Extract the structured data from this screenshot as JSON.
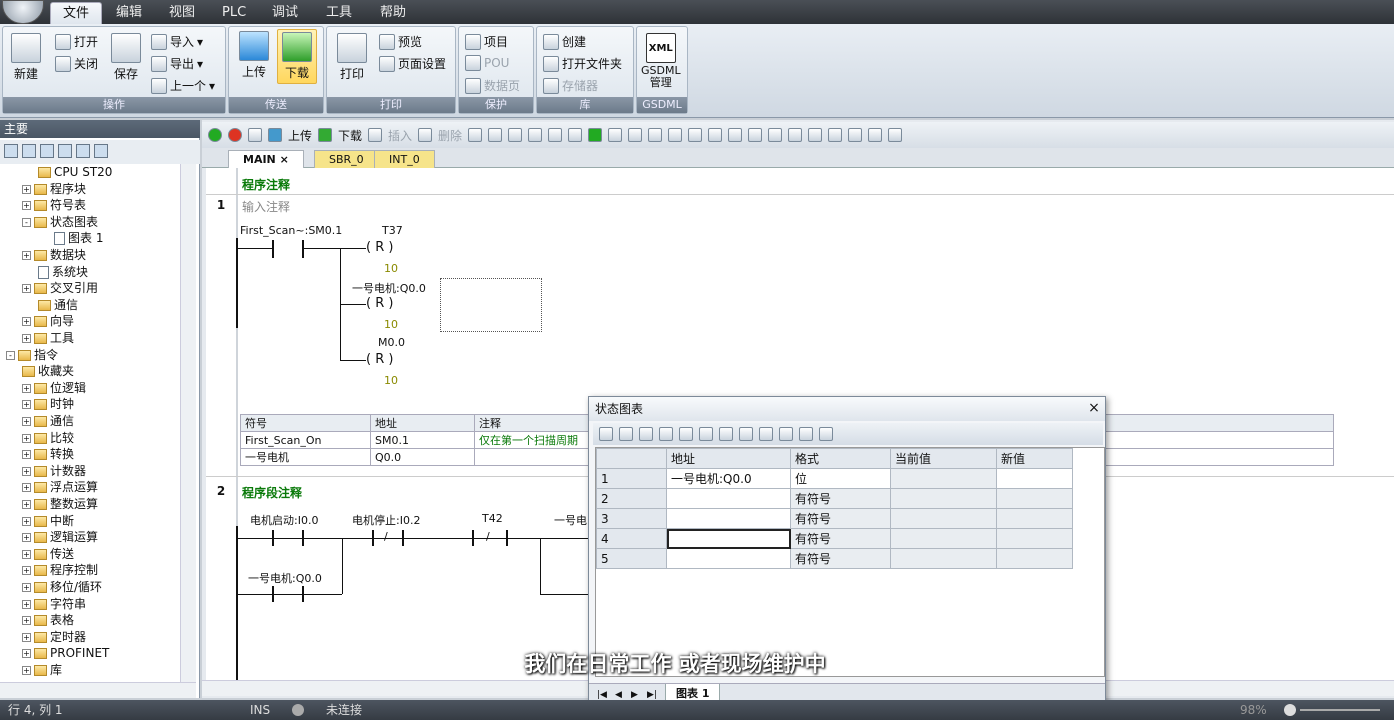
{
  "menubar": {
    "items": [
      "文件",
      "编辑",
      "视图",
      "PLC",
      "调试",
      "工具",
      "帮助"
    ]
  },
  "ribbon": {
    "groups": {
      "ops": {
        "label": "操作",
        "new": "新建",
        "open": "打开",
        "close": "关闭",
        "save": "保存",
        "import": "导入",
        "export": "导出",
        "prev": "上一个"
      },
      "transfer": {
        "label": "传送",
        "upload": "上传",
        "download": "下载"
      },
      "print": {
        "label": "打印",
        "print": "打印",
        "preview": "预览",
        "page_setup": "页面设置"
      },
      "protect": {
        "label": "保护",
        "project": "项目",
        "pou": "POU",
        "datapage": "数据页"
      },
      "library": {
        "label": "库",
        "create": "创建",
        "open_folder": "打开文件夹",
        "storage": "存储器"
      },
      "gsdml": {
        "label": "GSDML",
        "btn": "GSDML\n管理",
        "xml": "XML"
      }
    }
  },
  "left_panel": {
    "title": "主要",
    "tree": [
      {
        "label": "CPU ST20",
        "level": 2,
        "pm": "",
        "icon": "cpu"
      },
      {
        "label": "程序块",
        "level": 1,
        "pm": "+",
        "icon": "folder"
      },
      {
        "label": "符号表",
        "level": 1,
        "pm": "+",
        "icon": "folder"
      },
      {
        "label": "状态图表",
        "level": 1,
        "pm": "-",
        "icon": "folder"
      },
      {
        "label": "图表 1",
        "level": 3,
        "pm": "",
        "icon": "doc"
      },
      {
        "label": "数据块",
        "level": 1,
        "pm": "+",
        "icon": "folder"
      },
      {
        "label": "系统块",
        "level": 2,
        "pm": "",
        "icon": "doc"
      },
      {
        "label": "交叉引用",
        "level": 1,
        "pm": "+",
        "icon": "folder"
      },
      {
        "label": "通信",
        "level": 2,
        "pm": "",
        "icon": "pc"
      },
      {
        "label": "向导",
        "level": 1,
        "pm": "+",
        "icon": "folder"
      },
      {
        "label": "工具",
        "level": 1,
        "pm": "+",
        "icon": "folder"
      },
      {
        "label": "指令",
        "level": 0,
        "pm": "-",
        "icon": "folder"
      },
      {
        "label": "收藏夹",
        "level": 1,
        "pm": "",
        "icon": "folder"
      },
      {
        "label": "位逻辑",
        "level": 1,
        "pm": "+",
        "icon": "folder"
      },
      {
        "label": "时钟",
        "level": 1,
        "pm": "+",
        "icon": "folder"
      },
      {
        "label": "通信",
        "level": 1,
        "pm": "+",
        "icon": "folder"
      },
      {
        "label": "比较",
        "level": 1,
        "pm": "+",
        "icon": "folder"
      },
      {
        "label": "转换",
        "level": 1,
        "pm": "+",
        "icon": "folder"
      },
      {
        "label": "计数器",
        "level": 1,
        "pm": "+",
        "icon": "folder"
      },
      {
        "label": "浮点运算",
        "level": 1,
        "pm": "+",
        "icon": "folder"
      },
      {
        "label": "整数运算",
        "level": 1,
        "pm": "+",
        "icon": "folder"
      },
      {
        "label": "中断",
        "level": 1,
        "pm": "+",
        "icon": "folder"
      },
      {
        "label": "逻辑运算",
        "level": 1,
        "pm": "+",
        "icon": "folder"
      },
      {
        "label": "传送",
        "level": 1,
        "pm": "+",
        "icon": "folder"
      },
      {
        "label": "程序控制",
        "level": 1,
        "pm": "+",
        "icon": "folder"
      },
      {
        "label": "移位/循环",
        "level": 1,
        "pm": "+",
        "icon": "folder"
      },
      {
        "label": "字符串",
        "level": 1,
        "pm": "+",
        "icon": "folder"
      },
      {
        "label": "表格",
        "level": 1,
        "pm": "+",
        "icon": "folder"
      },
      {
        "label": "定时器",
        "level": 1,
        "pm": "+",
        "icon": "folder"
      },
      {
        "label": "PROFINET",
        "level": 1,
        "pm": "+",
        "icon": "folder"
      },
      {
        "label": "库",
        "level": 1,
        "pm": "+",
        "icon": "folder"
      }
    ]
  },
  "editor": {
    "toolbar": {
      "upload": "上传",
      "download": "下载",
      "insert": "插入",
      "delete": "删除"
    },
    "tabs": [
      "MAIN",
      "SBR_0",
      "INT_0"
    ],
    "program_comment": "程序注释",
    "network1": {
      "no": "1",
      "input_comment": "输入注释",
      "contact": "First_Scan~:SM0.1",
      "coil1": {
        "name": "T37",
        "op": "R",
        "n": "10"
      },
      "coil2": {
        "name": "一号电机:Q0.0",
        "op": "R",
        "n": "10"
      },
      "coil3": {
        "name": "M0.0",
        "op": "R",
        "n": "10"
      },
      "symbols": {
        "headers": [
          "符号",
          "地址",
          "注释"
        ],
        "rows": [
          [
            "First_Scan_On",
            "SM0.1",
            "仅在第一个扫描周期"
          ],
          [
            "一号电机",
            "Q0.0",
            ""
          ]
        ]
      }
    },
    "network2": {
      "no": "2",
      "comment": "程序段注释",
      "c1": "电机启动:I0.0",
      "c2": "电机停止:I0.2",
      "c3": "T42",
      "c4": "一号电",
      "c5": "一号电机:Q0.0",
      "not": "/"
    }
  },
  "status_chart": {
    "title": "状态图表",
    "close": "×",
    "headers": [
      "",
      "地址",
      "格式",
      "当前值",
      "新值"
    ],
    "rows": [
      [
        "1",
        "一号电机:Q0.0",
        "位",
        "",
        ""
      ],
      [
        "2",
        "",
        "有符号",
        "",
        ""
      ],
      [
        "3",
        "",
        "有符号",
        "",
        ""
      ],
      [
        "4",
        "",
        "有符号",
        "",
        ""
      ],
      [
        "5",
        "",
        "有符号",
        "",
        ""
      ]
    ],
    "tab": "图表 1"
  },
  "subtitle": "我们在日常工作 或者现场维护中",
  "statusbar": {
    "pos": "行 4, 列 1",
    "ins": "INS",
    "conn": "未连接",
    "zoom": "98%"
  }
}
